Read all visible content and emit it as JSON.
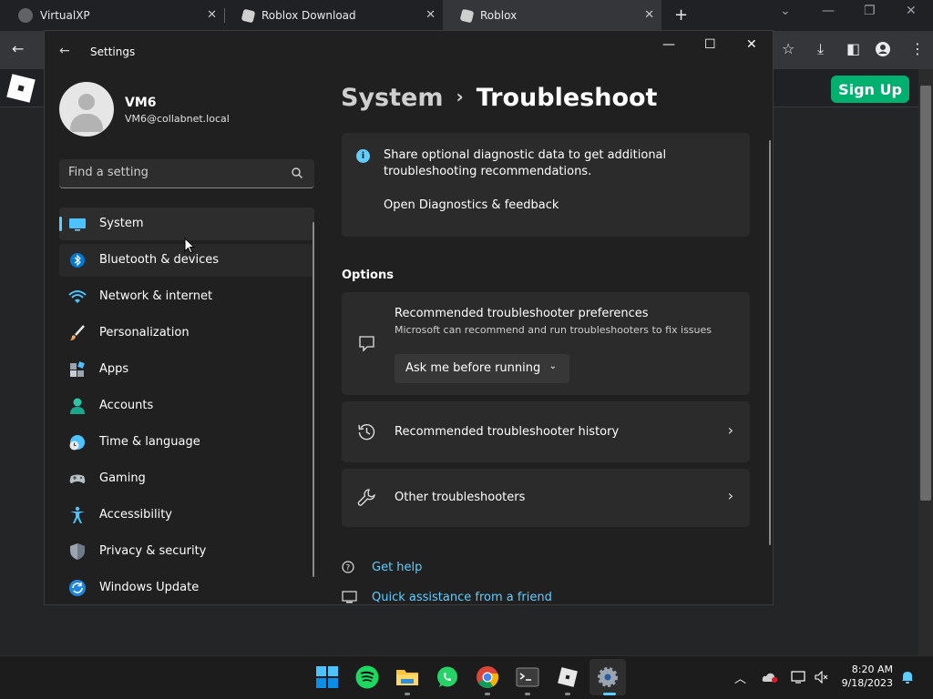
{
  "browser": {
    "tabs": [
      {
        "title": "VirtualXP"
      },
      {
        "title": "Roblox Download"
      },
      {
        "title": "Roblox"
      }
    ],
    "new_tab": "+"
  },
  "roblox": {
    "signup_label": "Sign Up",
    "accent": "#00b06f"
  },
  "settings": {
    "window_title": "Settings",
    "user": {
      "name": "VM6",
      "email": "VM6@collabnet.local"
    },
    "search": {
      "placeholder": "Find a setting"
    },
    "nav": [
      {
        "label": "System",
        "icon": "monitor-icon",
        "selected": true
      },
      {
        "label": "Bluetooth & devices",
        "icon": "bluetooth-icon"
      },
      {
        "label": "Network & internet",
        "icon": "wifi-icon"
      },
      {
        "label": "Personalization",
        "icon": "paintbrush-icon"
      },
      {
        "label": "Apps",
        "icon": "apps-icon"
      },
      {
        "label": "Accounts",
        "icon": "person-icon"
      },
      {
        "label": "Time & language",
        "icon": "globe-clock-icon"
      },
      {
        "label": "Gaming",
        "icon": "gamepad-icon"
      },
      {
        "label": "Accessibility",
        "icon": "accessibility-icon"
      },
      {
        "label": "Privacy & security",
        "icon": "shield-icon"
      },
      {
        "label": "Windows Update",
        "icon": "update-icon"
      }
    ],
    "breadcrumb": {
      "parent": "System",
      "separator": "›",
      "current": "Troubleshoot"
    },
    "diagnostics": {
      "text_line1": "Share optional diagnostic data to get additional",
      "text_line2": "troubleshooting recommendations.",
      "link": "Open Diagnostics & feedback"
    },
    "options_heading": "Options",
    "preferences": {
      "title": "Recommended troubleshooter preferences",
      "subtitle": "Microsoft can recommend and run troubleshooters to fix issues",
      "dropdown_value": "Ask me before running"
    },
    "history_label": "Recommended troubleshooter history",
    "other_label": "Other troubleshooters",
    "help_links": [
      {
        "label": "Get help",
        "icon": "help-icon"
      },
      {
        "label": "Quick assistance from a friend",
        "icon": "quick-assist-icon"
      }
    ],
    "accent": "#60cdff"
  },
  "taskbar": {
    "time": "8:20 AM",
    "date": "9/18/2023"
  }
}
